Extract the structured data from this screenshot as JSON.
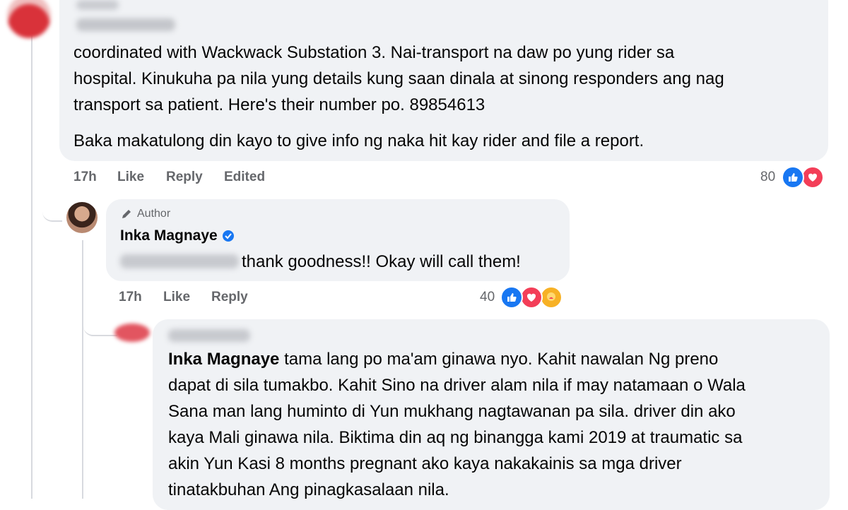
{
  "comment1": {
    "text_line1": "coordinated with Wackwack Substation 3. Nai-transport na daw po yung rider sa",
    "text_line2": "hospital. Kinukuha pa nila yung details kung saan dinala at sinong responders ang nag",
    "text_line3": "transport sa patient. Here's their number po. 89854613",
    "text_para2": "Baka makatulong din kayo to give info ng naka hit kay rider and file a report.",
    "time": "17h",
    "like": "Like",
    "reply": "Reply",
    "edited": "Edited",
    "reaction_count": "80",
    "reactions": [
      "like-icon",
      "love-icon"
    ]
  },
  "reply1": {
    "author_badge": "Author",
    "name": "Inka Magnaye",
    "text": "thank goodness!! Okay will call them!",
    "time": "17h",
    "like": "Like",
    "reply": "Reply",
    "reaction_count": "40",
    "reactions": [
      "like-icon",
      "love-icon",
      "care-icon"
    ]
  },
  "reply2": {
    "mention": "Inka Magnaye",
    "line1": " tama lang po ma'am ginawa nyo. Kahit nawalan Ng preno",
    "line2": "dapat di sila tumakbo. Kahit Sino na driver alam nila if may natamaan o Wala",
    "line3": "Sana man lang huminto di Yun mukhang nagtawanan pa sila. driver din ako",
    "line4": "kaya Mali ginawa nila. Biktima din aq ng binangga kami 2019 at traumatic sa",
    "line5": "akin Yun Kasi 8 months pregnant ako kaya nakakainis sa mga driver",
    "line6": "tinatakbuhan Ang pinagkasalaan nila."
  },
  "colors": {
    "bubble": "#f0f2f5",
    "meta": "#65676b",
    "like": "#1877f2",
    "love": "#f33e58",
    "verified": "#1877f2"
  }
}
